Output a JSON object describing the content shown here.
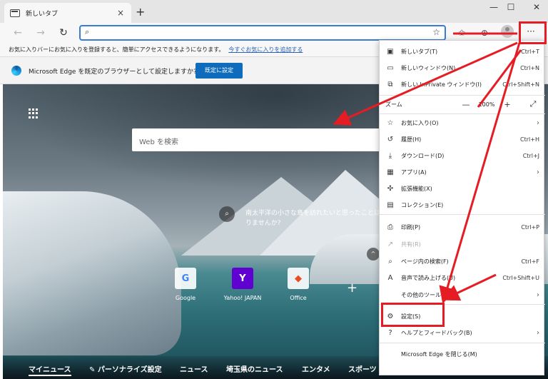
{
  "tab": {
    "title": "新しいタブ"
  },
  "favbar": {
    "text": "お気に入りバーにお気に入りを登録すると、簡単にアクセスできるようになります。",
    "link": "今すぐお気に入りを追加する"
  },
  "infobar": {
    "text": "Microsoft Edge を既定のブラウザーとして設定しますか?",
    "button": "既定に設定"
  },
  "content": {
    "search_placeholder": "Web を検索",
    "spotlight": "南太平洋の小さな島を訪れたいと思ったことはありませんか?",
    "tiles": [
      {
        "label": "Google",
        "letter": "G"
      },
      {
        "label": "Yahoo! JAPAN",
        "letter": "Y"
      },
      {
        "label": "Office",
        "letter": "◆"
      }
    ],
    "news": [
      "マイニュース",
      "パーソナライズ設定",
      "ニュース",
      "埼玉県のニュース",
      "エンタメ",
      "スポーツ"
    ]
  },
  "menu": {
    "items": [
      {
        "icon": "▣",
        "label": "新しいタブ(T)",
        "shortcut": "Ctrl+T"
      },
      {
        "icon": "▭",
        "label": "新しいウィンドウ(N)",
        "shortcut": "Ctrl+N"
      },
      {
        "icon": "⧉",
        "label": "新しい InPrivate ウィンドウ(I)",
        "shortcut": "Ctrl+Shift+N"
      },
      {
        "icon": "☆",
        "label": "お気に入り(O)",
        "arrow": "›"
      },
      {
        "icon": "↺",
        "label": "履歴(H)",
        "shortcut": "Ctrl+H"
      },
      {
        "icon": "⤓",
        "label": "ダウンロード(D)",
        "shortcut": "Ctrl+J"
      },
      {
        "icon": "▦",
        "label": "アプリ(A)",
        "arrow": "›"
      },
      {
        "icon": "✣",
        "label": "拡張機能(X)"
      },
      {
        "icon": "▤",
        "label": "コレクション(E)"
      },
      {
        "icon": "⎙",
        "label": "印刷(P)",
        "shortcut": "Ctrl+P"
      },
      {
        "icon": "↗",
        "label": "共有(R)"
      },
      {
        "icon": "⌕",
        "label": "ページ内の検索(F)",
        "shortcut": "Ctrl+F"
      },
      {
        "icon": "A",
        "label": "音声で読み上げる(U)",
        "shortcut": "Ctrl+Shift+U"
      },
      {
        "icon": "",
        "label": "その他のツール(L)",
        "arrow": "›"
      },
      {
        "icon": "⚙",
        "label": "設定(S)"
      },
      {
        "icon": "?",
        "label": "ヘルプとフィードバック(B)",
        "arrow": "›"
      },
      {
        "icon": "",
        "label": "Microsoft Edge を閉じる(M)"
      }
    ],
    "zoom": {
      "label": "ズーム",
      "minus": "—",
      "value": "100%",
      "plus": "+",
      "fullscreen": "⤢"
    }
  }
}
